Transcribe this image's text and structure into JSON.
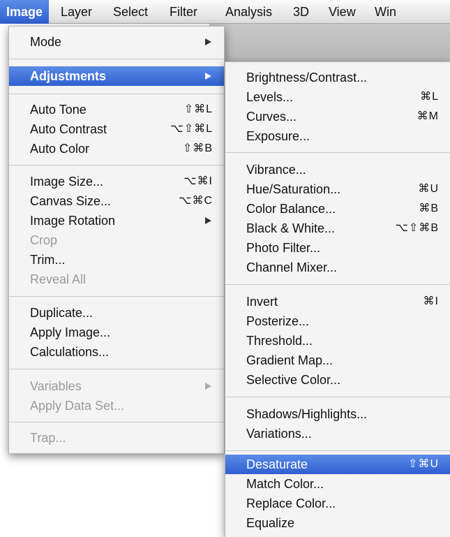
{
  "menubar": {
    "items": [
      "Image",
      "Layer",
      "Select",
      "Filter",
      "Analysis",
      "3D",
      "View",
      "Win"
    ]
  },
  "image_menu": {
    "items": [
      {
        "label": "Mode",
        "submenu": true
      },
      {
        "label": "Adjustments",
        "submenu": true,
        "highlighted": true
      },
      {
        "label": "Auto Tone",
        "shortcut": "⇧⌘L"
      },
      {
        "label": "Auto Contrast",
        "shortcut": "⌥⇧⌘L"
      },
      {
        "label": "Auto Color",
        "shortcut": "⇧⌘B"
      },
      {
        "label": "Image Size...",
        "shortcut": "⌥⌘I"
      },
      {
        "label": "Canvas Size...",
        "shortcut": "⌥⌘C"
      },
      {
        "label": "Image Rotation",
        "submenu": true
      },
      {
        "label": "Crop",
        "disabled": true
      },
      {
        "label": "Trim..."
      },
      {
        "label": "Reveal All",
        "disabled": true
      },
      {
        "label": "Duplicate..."
      },
      {
        "label": "Apply Image..."
      },
      {
        "label": "Calculations..."
      },
      {
        "label": "Variables",
        "submenu": true,
        "disabled": true
      },
      {
        "label": "Apply Data Set...",
        "disabled": true
      },
      {
        "label": "Trap...",
        "disabled": true
      }
    ]
  },
  "adjustments_menu": {
    "items": [
      {
        "label": "Brightness/Contrast..."
      },
      {
        "label": "Levels...",
        "shortcut": "⌘L"
      },
      {
        "label": "Curves...",
        "shortcut": "⌘M"
      },
      {
        "label": "Exposure..."
      },
      {
        "label": "Vibrance..."
      },
      {
        "label": "Hue/Saturation...",
        "shortcut": "⌘U"
      },
      {
        "label": "Color Balance...",
        "shortcut": "⌘B"
      },
      {
        "label": "Black & White...",
        "shortcut": "⌥⇧⌘B"
      },
      {
        "label": "Photo Filter..."
      },
      {
        "label": "Channel Mixer..."
      },
      {
        "label": "Invert",
        "shortcut": "⌘I"
      },
      {
        "label": "Posterize..."
      },
      {
        "label": "Threshold..."
      },
      {
        "label": "Gradient Map..."
      },
      {
        "label": "Selective Color..."
      },
      {
        "label": "Shadows/Highlights..."
      },
      {
        "label": "Variations..."
      },
      {
        "label": "Desaturate",
        "shortcut": "⇧⌘U",
        "highlighted": true
      },
      {
        "label": "Match Color..."
      },
      {
        "label": "Replace Color..."
      },
      {
        "label": "Equalize"
      }
    ]
  },
  "colors": {
    "highlight": "#2f5fcf",
    "menu_bg": "#f4f4f4",
    "disabled_text": "#9a9a9a"
  }
}
